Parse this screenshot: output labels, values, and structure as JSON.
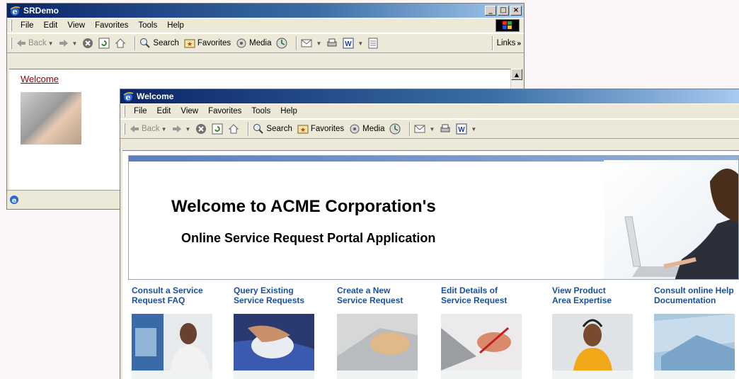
{
  "back_window": {
    "title": "SRDemo",
    "menu": [
      "File",
      "Edit",
      "View",
      "Favorites",
      "Tools",
      "Help"
    ],
    "toolbar": {
      "back": "Back",
      "search": "Search",
      "favorites": "Favorites",
      "media": "Media",
      "links": "Links"
    },
    "content": {
      "link": "Welcome"
    },
    "icons": [
      "ie-logo-icon",
      "windows-flag-icon",
      "back-arrow-icon",
      "forward-arrow-icon",
      "stop-icon",
      "refresh-icon",
      "home-icon",
      "search-icon",
      "favorites-icon",
      "media-icon",
      "history-icon",
      "mail-icon",
      "print-icon",
      "edit-icon",
      "discuss-icon"
    ]
  },
  "front_window": {
    "title": "Welcome",
    "menu": [
      "File",
      "Edit",
      "View",
      "Favorites",
      "Tools",
      "Help"
    ],
    "toolbar": {
      "back": "Back",
      "search": "Search",
      "favorites": "Favorites",
      "media": "Media"
    },
    "hero": {
      "title": "Welcome to ACME Corporation's",
      "subtitle": "Online Service Request Portal Application"
    },
    "links": [
      {
        "line1": "Consult a Service",
        "line2": "Request FAQ"
      },
      {
        "line1": "Query Existing",
        "line2": "Service Requests"
      },
      {
        "line1": "Create a New",
        "line2": "Service Request"
      },
      {
        "line1": "Edit Details of",
        "line2": "Service Request"
      },
      {
        "line1": "View Product",
        "line2": "Area Expertise"
      },
      {
        "line1": "Consult online Help",
        "line2": "Documentation"
      }
    ]
  },
  "colors": {
    "title_bar": "#0a246a",
    "link": "#1b4fa0",
    "visited_link": "#8b0000",
    "chrome": "#ece9d8"
  }
}
